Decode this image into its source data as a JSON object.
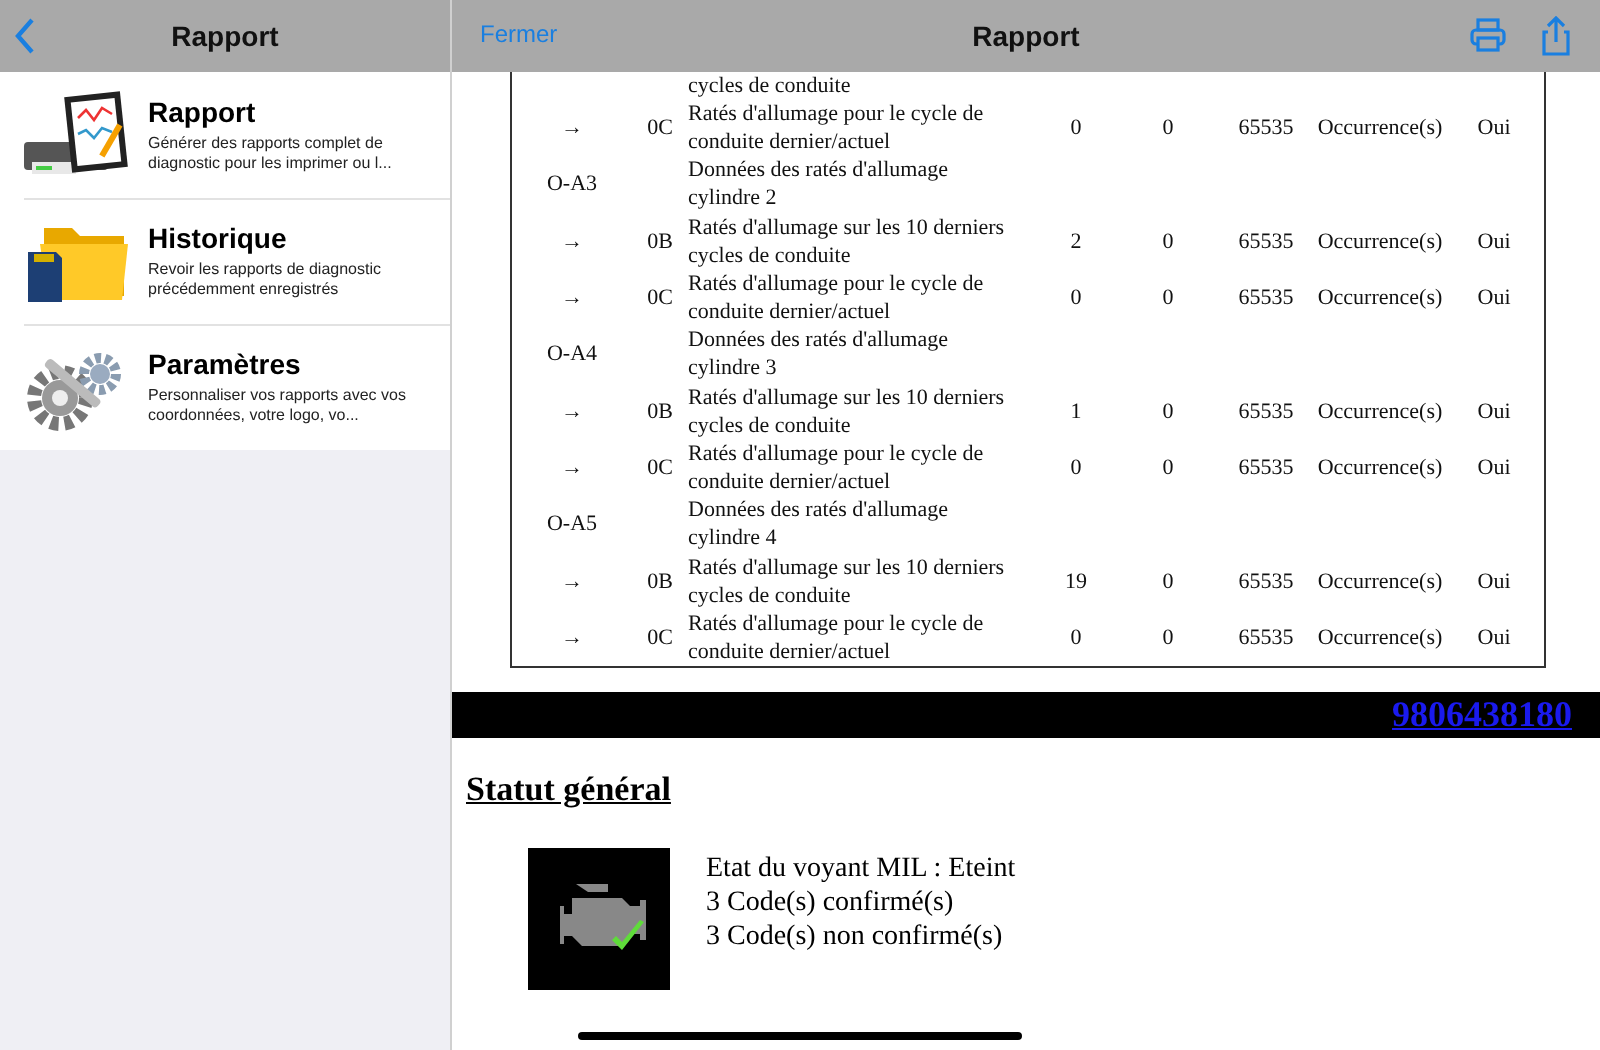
{
  "sidebar": {
    "title": "Rapport",
    "items": [
      {
        "kind": "report",
        "title": "Rapport",
        "description": "Générer des rapports complet de diagnostic pour les imprimer ou l..."
      },
      {
        "kind": "folder",
        "title": "Historique",
        "description": "Revoir les rapports de diagnostic précédemment enregistrés"
      },
      {
        "kind": "settings",
        "title": "Paramètres",
        "description": "Personnaliser vos rapports avec vos coordonnées, votre logo, vo..."
      }
    ]
  },
  "header": {
    "close": "Fermer",
    "title": "Rapport"
  },
  "table": {
    "rows": [
      {
        "kind": "continuation",
        "description": "cycles de conduite"
      },
      {
        "kind": "item",
        "marker": "→",
        "code": "0C",
        "description": "Ratés d'allumage pour le cycle de conduite dernier/actuel",
        "value": "0",
        "min": "0",
        "max": "65535",
        "unit": "Occurrence(s)",
        "valid": "Oui"
      },
      {
        "kind": "group",
        "code": "O-A3",
        "description": "Données des ratés d'allumage cylindre 2"
      },
      {
        "kind": "item",
        "marker": "→",
        "code": "0B",
        "description": "Ratés d'allumage sur les 10 derniers cycles de conduite",
        "value": "2",
        "min": "0",
        "max": "65535",
        "unit": "Occurrence(s)",
        "valid": "Oui"
      },
      {
        "kind": "item",
        "marker": "→",
        "code": "0C",
        "description": "Ratés d'allumage pour le cycle de conduite dernier/actuel",
        "value": "0",
        "min": "0",
        "max": "65535",
        "unit": "Occurrence(s)",
        "valid": "Oui"
      },
      {
        "kind": "group",
        "code": "O-A4",
        "description": "Données des ratés d'allumage cylindre 3"
      },
      {
        "kind": "item",
        "marker": "→",
        "code": "0B",
        "description": "Ratés d'allumage sur les 10 derniers cycles de conduite",
        "value": "1",
        "min": "0",
        "max": "65535",
        "unit": "Occurrence(s)",
        "valid": "Oui"
      },
      {
        "kind": "item",
        "marker": "→",
        "code": "0C",
        "description": "Ratés d'allumage pour le cycle de conduite dernier/actuel",
        "value": "0",
        "min": "0",
        "max": "65535",
        "unit": "Occurrence(s)",
        "valid": "Oui"
      },
      {
        "kind": "group",
        "code": "O-A5",
        "description": "Données des ratés d'allumage cylindre 4"
      },
      {
        "kind": "item",
        "marker": "→",
        "code": "0B",
        "description": "Ratés d'allumage sur les 10 derniers cycles de conduite",
        "value": "19",
        "min": "0",
        "max": "65535",
        "unit": "Occurrence(s)",
        "valid": "Oui"
      },
      {
        "kind": "item",
        "marker": "→",
        "code": "0C",
        "description": "Ratés d'allumage pour le cycle de conduite dernier/actuel",
        "value": "0",
        "min": "0",
        "max": "65535",
        "unit": "Occurrence(s)",
        "valid": "Oui"
      }
    ]
  },
  "phone_link": "9806438180",
  "status": {
    "title": "Statut général",
    "lines": [
      "Etat du voyant MIL : Eteint",
      "3 Code(s) confirmé(s)",
      "3 Code(s) non confirmé(s)"
    ]
  }
}
